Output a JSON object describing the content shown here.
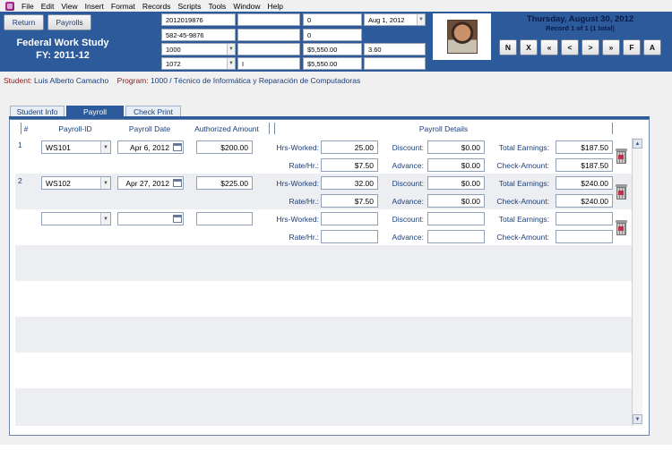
{
  "menu": [
    "File",
    "Edit",
    "View",
    "Insert",
    "Format",
    "Records",
    "Scripts",
    "Tools",
    "Window",
    "Help"
  ],
  "header": {
    "return_label": "Return",
    "payrolls_label": "Payrolls",
    "title_line1": "Federal Work Study",
    "title_line2": "FY: 2011-12",
    "fields": {
      "r1c1": "2012019876",
      "r1c2": "",
      "r1c3": "0",
      "r1c4": "Aug 1, 2012",
      "r2c1": "582-45-9876",
      "r2c2": "",
      "r2c3": "0",
      "r3c1": "1000",
      "r3c2": "",
      "r3c3": "$5,550.00",
      "r3c4": "3.60",
      "r4c1": "1072",
      "r4c2": "I",
      "r4c3": "$5,550.00",
      "r4c4": ""
    },
    "date": "Thursday, August 30, 2012",
    "record_status": "Record 1 of 1 (1 total)",
    "nav_buttons": [
      "N",
      "X",
      "«",
      "<",
      ">",
      "»",
      "F",
      "A"
    ]
  },
  "student": {
    "student_label": "Student:",
    "student_name": "Luis Alberto Camacho",
    "program_label": "Program:",
    "program_value": "1000  /  Técnico de Informática y Reparación de Computadoras"
  },
  "tabs": [
    "Student Info",
    "Payroll",
    "Check Print"
  ],
  "columns": {
    "num": "#",
    "payroll_id": "Payroll-ID",
    "payroll_date": "Payroll Date",
    "authorized_amount": "Authorized Amount",
    "payroll_details": "Payroll Details"
  },
  "labels": {
    "hrs_worked": "Hrs-Worked:",
    "rate_hr": "Rate/Hr.:",
    "discount": "Discount:",
    "advance": "Advance:",
    "total_earnings": "Total Earnings:",
    "check_amount": "Check-Amount:"
  },
  "rows": [
    {
      "num": "1",
      "payroll_id": "WS101",
      "date": "Apr 6, 2012",
      "amount": "$200.00",
      "hrs": "25.00",
      "rate": "$7.50",
      "discount": "$0.00",
      "advance": "$0.00",
      "total": "$187.50",
      "check": "$187.50"
    },
    {
      "num": "2",
      "payroll_id": "WS102",
      "date": "Apr 27, 2012",
      "amount": "$225.00",
      "hrs": "32.00",
      "rate": "$7.50",
      "discount": "$0.00",
      "advance": "$0.00",
      "total": "$240.00",
      "check": "$240.00"
    },
    {
      "num": "",
      "payroll_id": "",
      "date": "",
      "amount": "",
      "hrs": "",
      "rate": "",
      "discount": "",
      "advance": "",
      "total": "",
      "check": ""
    }
  ],
  "colors": {
    "header_blue": "#2c5a9a",
    "row_alt": "#eceef2",
    "label_red": "#8b1a1a",
    "text_blue": "#1a3f7a"
  },
  "icons": {
    "app": "filemaker-app-icon",
    "delete": "trash-icon",
    "calendar": "calendar-icon",
    "dropdown": "chevron-down-icon"
  }
}
